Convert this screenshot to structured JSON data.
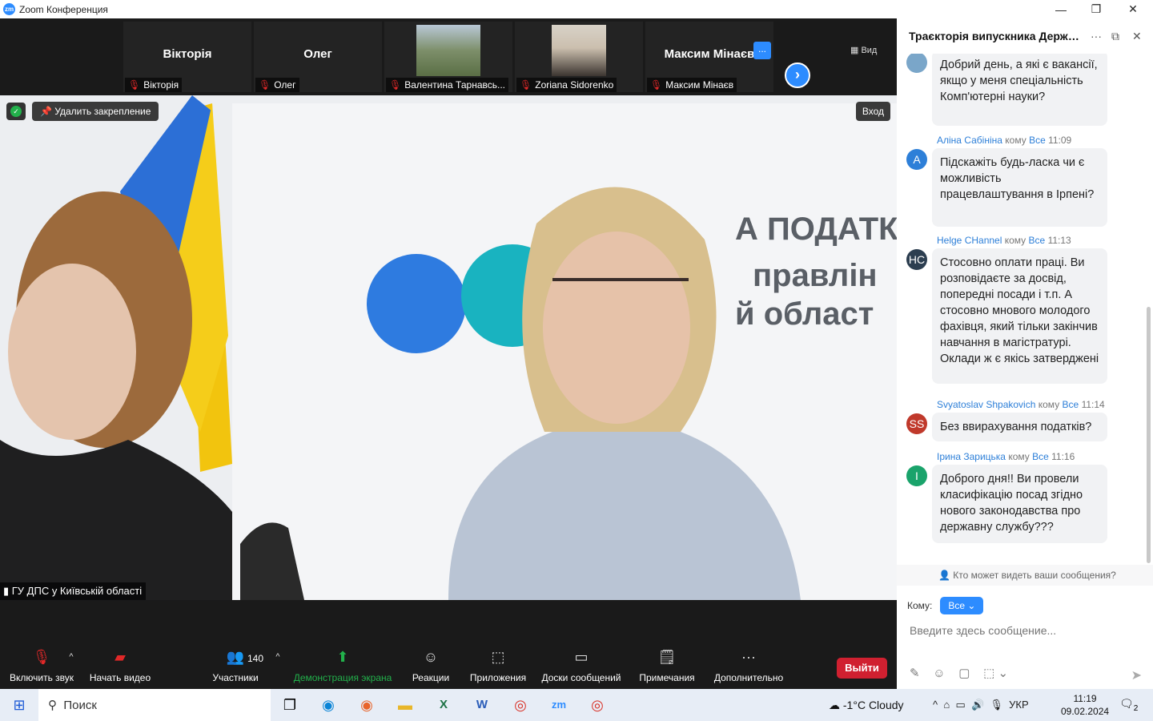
{
  "window": {
    "title": "Zoom Конференция",
    "logo": "zm",
    "controls": [
      "minimize-icon",
      "restore-icon",
      "close-icon"
    ]
  },
  "strip": {
    "tiles": [
      {
        "name": "Вікторія",
        "label": "Вікторія",
        "muted": true
      },
      {
        "name": "Олег",
        "label": "Олег",
        "muted": true
      },
      {
        "name": "",
        "label": "Валентина Тарнавсь...",
        "muted": true
      },
      {
        "name": "",
        "label": "Zoriana Sidorenko",
        "muted": true
      },
      {
        "name": "Максим Мінаєв",
        "label": "Максим Мінаєв",
        "muted": true
      }
    ],
    "more_button": "...",
    "view_label": "Вид",
    "next_icon": "chevron-right-icon"
  },
  "video": {
    "unpin_label": "Удалить закрепление",
    "enter_label": "Вход",
    "speaker_label": "ГУ ДПС у Київській області",
    "background_text_line1": "А ПОДАТК",
    "background_text_line2": "правлін",
    "background_text_line3": "й област"
  },
  "toolbar": {
    "mute": "Включить звук",
    "video": "Начать видео",
    "participants": "Участники",
    "participants_count": "140",
    "share": "Демонстрация экрана",
    "reactions": "Реакции",
    "apps": "Приложения",
    "whiteboards": "Доски сообщений",
    "notes": "Примечания",
    "more": "Дополнительно",
    "leave": "Выйти"
  },
  "chat": {
    "title": "Траєкторія випускника Держав...",
    "messages": [
      {
        "sender": "",
        "to_word": "",
        "to": "",
        "time": "",
        "avatar": "",
        "avatar_color": "#7aa6c9",
        "text": "Добрий день, а які є вакансії, якщо у меня спеціальність Комп'ютерні науки?"
      },
      {
        "sender": "Аліна Сабініна",
        "to_word": "кому",
        "to": "Все",
        "time": "11:09",
        "avatar": "A",
        "avatar_color": "#2d7fd8",
        "text": "Підскажіть будь-ласка чи є можливість працевлаштування в Ірпені?"
      },
      {
        "sender": "Helge CHannel",
        "to_word": "кому",
        "to": "Все",
        "time": "11:13",
        "avatar": "HC",
        "avatar_color": "#2c3e50",
        "text": "Стосовно оплати праці. Ви розповідаєте за досвід, попередні посади і т.п. А стосовно мнового молодого фахівця, який тільки закінчив навчання в магістратурі. Оклади ж є якісь затверджені"
      },
      {
        "sender": "Svyatoslav Shpakovich",
        "to_word": "кому",
        "to": "Все",
        "time": "11:14",
        "avatar": "SS",
        "avatar_color": "#c0392b",
        "text": "Без ввирахування податків?"
      },
      {
        "sender": "Ірина Зарицька",
        "to_word": "кому",
        "to": "Все",
        "time": "11:16",
        "avatar": "I",
        "avatar_color": "#1aa36b",
        "text": "Доброго дня!! Ви провели класифікацію посад згідно нового законодавства про державну службу???"
      }
    ],
    "who_can_see": "Кто может видеть ваши сообщения?",
    "to_label": "Кому:",
    "to_value": "Все",
    "input_placeholder": "Введите здесь сообщение..."
  },
  "taskbar": {
    "search": "Поиск",
    "weather": "-1°C  Cloudy",
    "lang": "УКР",
    "time": "11:19",
    "date": "09.02.2024",
    "notifications": "2"
  }
}
